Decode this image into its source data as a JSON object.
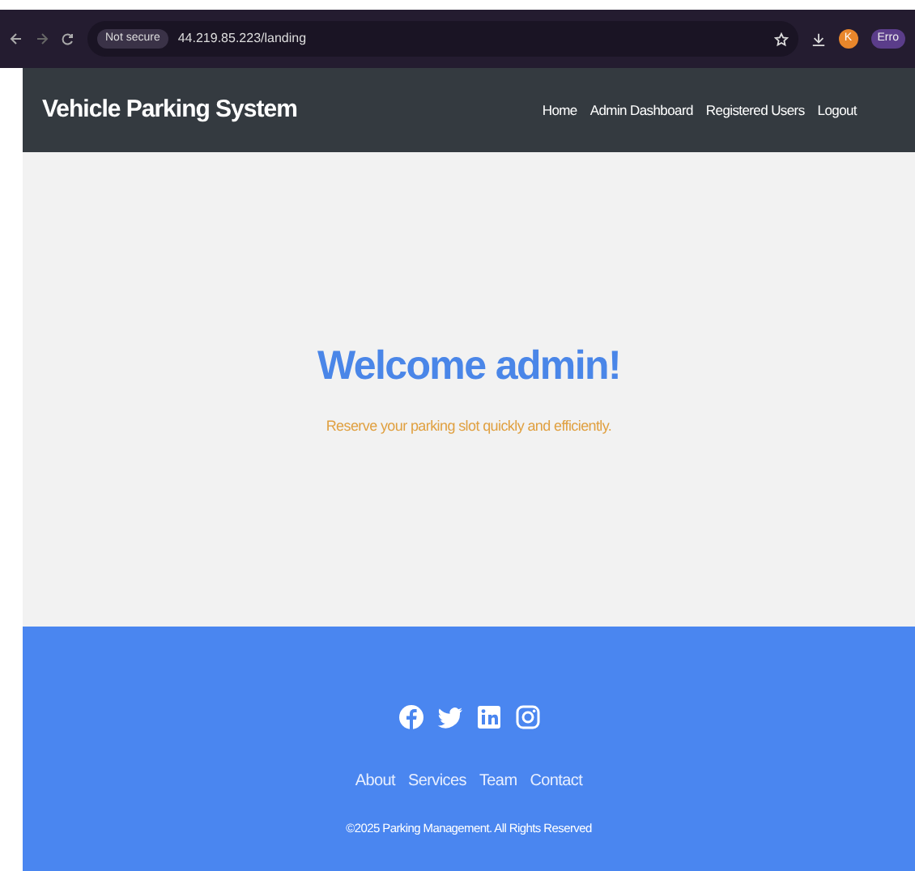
{
  "browser": {
    "security_label": "Not secure",
    "url": "44.219.85.223/landing",
    "profile_initial": "K",
    "profile_label": "Erro"
  },
  "navbar": {
    "brand": "Vehicle Parking System",
    "links": [
      {
        "label": "Home"
      },
      {
        "label": "Admin Dashboard"
      },
      {
        "label": "Registered Users"
      },
      {
        "label": "Logout"
      }
    ]
  },
  "hero": {
    "title": "Welcome admin!",
    "subtitle": "Reserve your parking slot quickly and efficiently."
  },
  "footer": {
    "social": [
      {
        "kind": "facebook"
      },
      {
        "kind": "twitter"
      },
      {
        "kind": "linkedin"
      },
      {
        "kind": "instagram"
      }
    ],
    "links": [
      {
        "label": "About"
      },
      {
        "label": "Services"
      },
      {
        "label": "Team"
      },
      {
        "label": "Contact"
      }
    ],
    "copyright": "©2025 Parking Management. All Rights Reserved"
  }
}
